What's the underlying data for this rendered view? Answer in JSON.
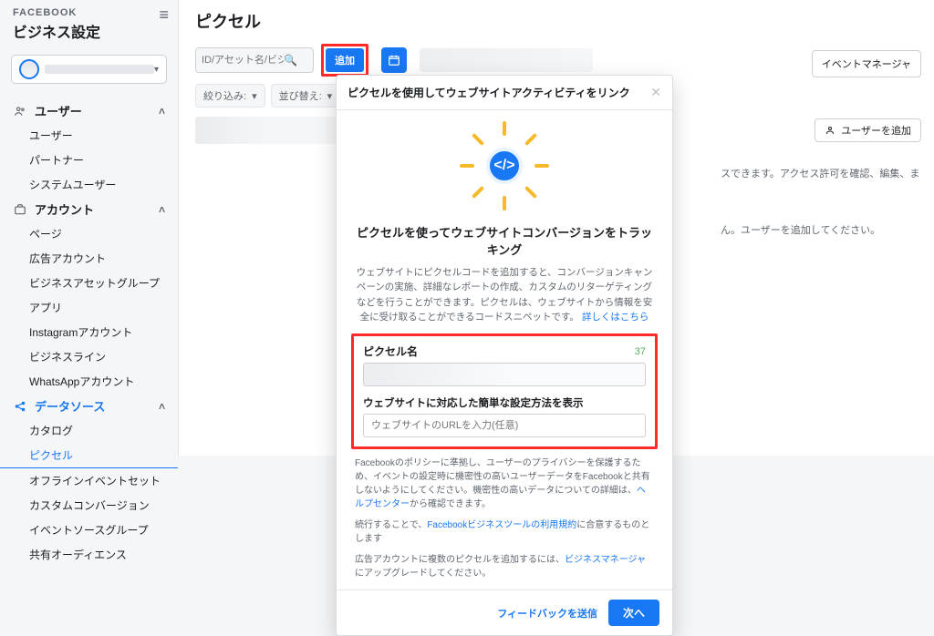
{
  "brand": "FACEBOOK",
  "settings_title": "ビジネス設定",
  "page_title": "ピクセル",
  "search": {
    "placeholder": "ID/アセット名/ビジネス名..."
  },
  "add_button": "追加",
  "filters": {
    "narrow": "絞り込み:",
    "sort": "並び替え:"
  },
  "events_manager_link": "イベントマネージャ",
  "sidebar": {
    "groups": [
      {
        "label": "ユーザー",
        "items": [
          "ユーザー",
          "パートナー",
          "システムユーザー"
        ]
      },
      {
        "label": "アカウント",
        "items": [
          "ページ",
          "広告アカウント",
          "ビジネスアセットグループ",
          "アプリ",
          "Instagramアカウント",
          "ビジネスライン",
          "WhatsAppアカウント"
        ]
      },
      {
        "label": "データソース",
        "active": true,
        "items": [
          "カタログ",
          "ピクセル",
          "オフラインイベントセット",
          "カスタムコンバージョン",
          "イベントソースグループ",
          "共有オーディエンス"
        ],
        "active_item": "ピクセル"
      }
    ]
  },
  "right": {
    "add_user": "ユーザーを追加",
    "body_line1": "スできます。アクセス許可を確認、編集、ま",
    "body_line2": "ん。ユーザーを追加してください。"
  },
  "modal": {
    "title": "ピクセルを使用してウェブサイトアクティビティをリンク",
    "subtitle": "ピクセルを使ってウェブサイトコンバージョンをトラッキング",
    "desc": "ウェブサイトにピクセルコードを追加すると、コンバージョンキャンペーンの実施、詳細なレポートの作成、カスタムのリターゲティングなどを行うことができます。ピクセルは、ウェブサイトから情報を安全に受け取ることができるコードスニペットです。",
    "desc_link": "詳しくはこちら",
    "pixel_name_label": "ピクセル名",
    "pixel_name_counter": "37",
    "website_label": "ウェブサイトに対応した簡単な設定方法を表示",
    "website_placeholder": "ウェブサイトのURLを入力(任意)",
    "policy1": "Facebookのポリシーに準拠し、ユーザーのプライバシーを保護するため、イベントの設定時に機密性の高いユーザーデータをFacebookと共有しないようにしてください。機密性の高いデータについての詳細は、",
    "policy1_link": "ヘルプセンター",
    "policy1_tail": "から確認できます。",
    "policy2_pre": "続行することで、",
    "policy2_link": "Facebookビジネスツールの利用規約",
    "policy2_post": "に合意するものとします",
    "policy3_pre": "広告アカウントに複数のピクセルを追加するには、",
    "policy3_link": "ビジネスマネージャ",
    "policy3_post": "にアップグレードしてください。",
    "feedback": "フィードバックを送信",
    "next": "次へ"
  }
}
